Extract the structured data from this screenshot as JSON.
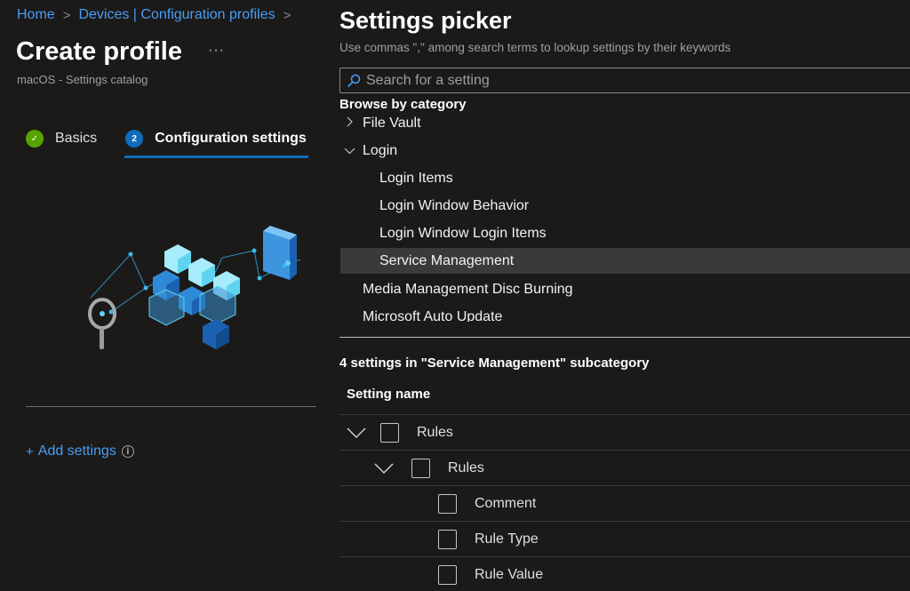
{
  "breadcrumb": {
    "items": [
      "Home",
      "Devices | Configuration profiles"
    ],
    "separator": ">"
  },
  "header": {
    "title": "Create profile",
    "more_label": "···",
    "subtitle": "macOS - Settings catalog"
  },
  "steps": [
    {
      "label": "Basics",
      "state": "completed",
      "badge": "✓"
    },
    {
      "label": "Configuration settings",
      "state": "active",
      "badge": "2"
    }
  ],
  "add_settings": {
    "plus": "+",
    "label": "Add settings",
    "info_icon": "i"
  },
  "picker": {
    "title": "Settings picker",
    "hint": "Use commas \",\" among search terms to lookup settings by their keywords",
    "search_placeholder": "Search for a setting",
    "search_value": "",
    "browse_label": "Browse by category",
    "categories": [
      {
        "label": "File Vault",
        "level": 0,
        "expandable": true,
        "expanded": false,
        "selected": false
      },
      {
        "label": "Login",
        "level": 0,
        "expandable": true,
        "expanded": true,
        "selected": false
      },
      {
        "label": "Login Items",
        "level": 1,
        "expandable": false,
        "selected": false
      },
      {
        "label": "Login Window Behavior",
        "level": 1,
        "expandable": false,
        "selected": false
      },
      {
        "label": "Login Window Login Items",
        "level": 1,
        "expandable": false,
        "selected": false
      },
      {
        "label": "Service Management",
        "level": 1,
        "expandable": false,
        "selected": true
      },
      {
        "label": "Media Management Disc Burning",
        "level": 0,
        "expandable": false,
        "selected": false
      },
      {
        "label": "Microsoft Auto Update",
        "level": 0,
        "expandable": false,
        "selected": false
      }
    ],
    "results_label": "4 settings in \"Service Management\" subcategory",
    "column_header": "Setting name",
    "settings": [
      {
        "name": "Rules",
        "level": 0,
        "expandable": true,
        "checked": false
      },
      {
        "name": "Rules",
        "level": 1,
        "expandable": true,
        "checked": false
      },
      {
        "name": "Comment",
        "level": 2,
        "expandable": false,
        "checked": false
      },
      {
        "name": "Rule Type",
        "level": 2,
        "expandable": false,
        "checked": false
      },
      {
        "name": "Rule Value",
        "level": 2,
        "expandable": false,
        "checked": false
      }
    ]
  },
  "colors": {
    "accent": "#0f6cbd",
    "link": "#479ef5",
    "success": "#57a300",
    "background": "#1b1a19",
    "selected_row": "#3b3a39"
  }
}
